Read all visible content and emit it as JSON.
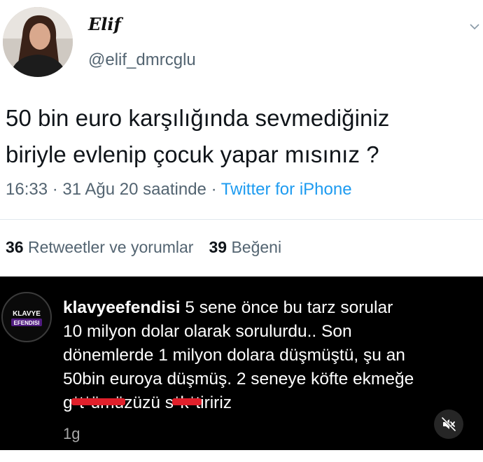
{
  "tweet": {
    "display_name": "Elif",
    "handle": "@elif_dmrcglu",
    "text_line1": "50 bin euro karşılığında sevmediğiniz",
    "text_line2": "biriyle evlenip çocuk yapar mısınız ?",
    "timestamp": "16:33 · 31 Ağu 20 saatinde · ",
    "source": "Twitter for iPhone",
    "stats": {
      "retweets_count": "36",
      "retweets_label": "Retweetler ve yorumlar",
      "likes_count": "39",
      "likes_label": "Beğeni"
    }
  },
  "comment": {
    "avatar_text_top": "KLAVYE",
    "avatar_text_bottom": "EFENDISI",
    "username": "klavyeefendisi",
    "line1": "5 sene önce bu tarz sorular",
    "line2": "10 milyon dolar olarak sorulurdu.. Son",
    "line3": "dönemlerde 1 milyon dolara düşmüştü, şu an",
    "line4": "50bin euroya düşmüş. 2 seneye köfte ekmeğe",
    "censored_word_1a": "g",
    "censored_word_1b": "*t*ümü",
    "censored_word_1c": "züzü ",
    "censored_word_2a": "s",
    "censored_word_2b": "*k*t",
    "censored_word_2c": "iririz",
    "time": "1g"
  },
  "colors": {
    "link": "#1d9bf0",
    "muted": "#536471",
    "censor_bar": "#e0202b",
    "comment_bg": "#000000"
  }
}
